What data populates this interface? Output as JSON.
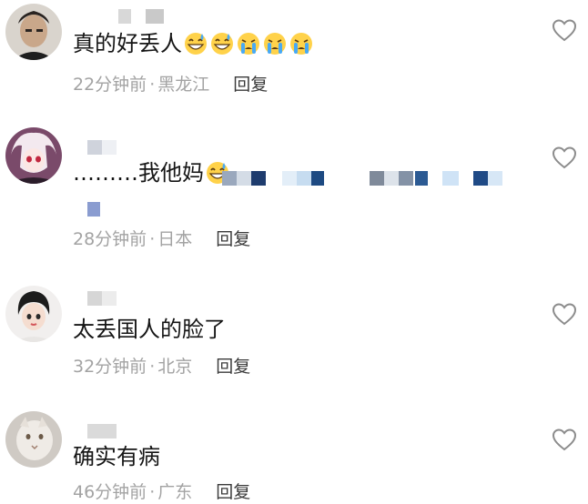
{
  "comments": [
    {
      "text": "真的好丢人",
      "emojis": [
        "grinning-sweat-icon",
        "grinning-sweat-icon",
        "crying-icon",
        "crying-icon",
        "crying-icon"
      ],
      "time": "22分钟前",
      "location": "黑龙江",
      "reply_label": "回复"
    },
    {
      "text": "………我他妈",
      "emojis": [
        "grinning-sweat-icon"
      ],
      "time": "28分钟前",
      "location": "日本",
      "reply_label": "回复"
    },
    {
      "text": "太丢国人的脸了",
      "emojis": [],
      "time": "32分钟前",
      "location": "北京",
      "reply_label": "回复"
    },
    {
      "text": "确实有病",
      "emojis": [],
      "time": "46分钟前",
      "location": "广东",
      "reply_label": "回复"
    }
  ],
  "meta_separator": "·",
  "colors": {
    "meta_text": "#a3a3a3",
    "reply_text": "#3a3a3a",
    "heart_stroke": "#8c8c8c",
    "emoji_face": "#ffd24a",
    "tear": "#48a9f5"
  }
}
